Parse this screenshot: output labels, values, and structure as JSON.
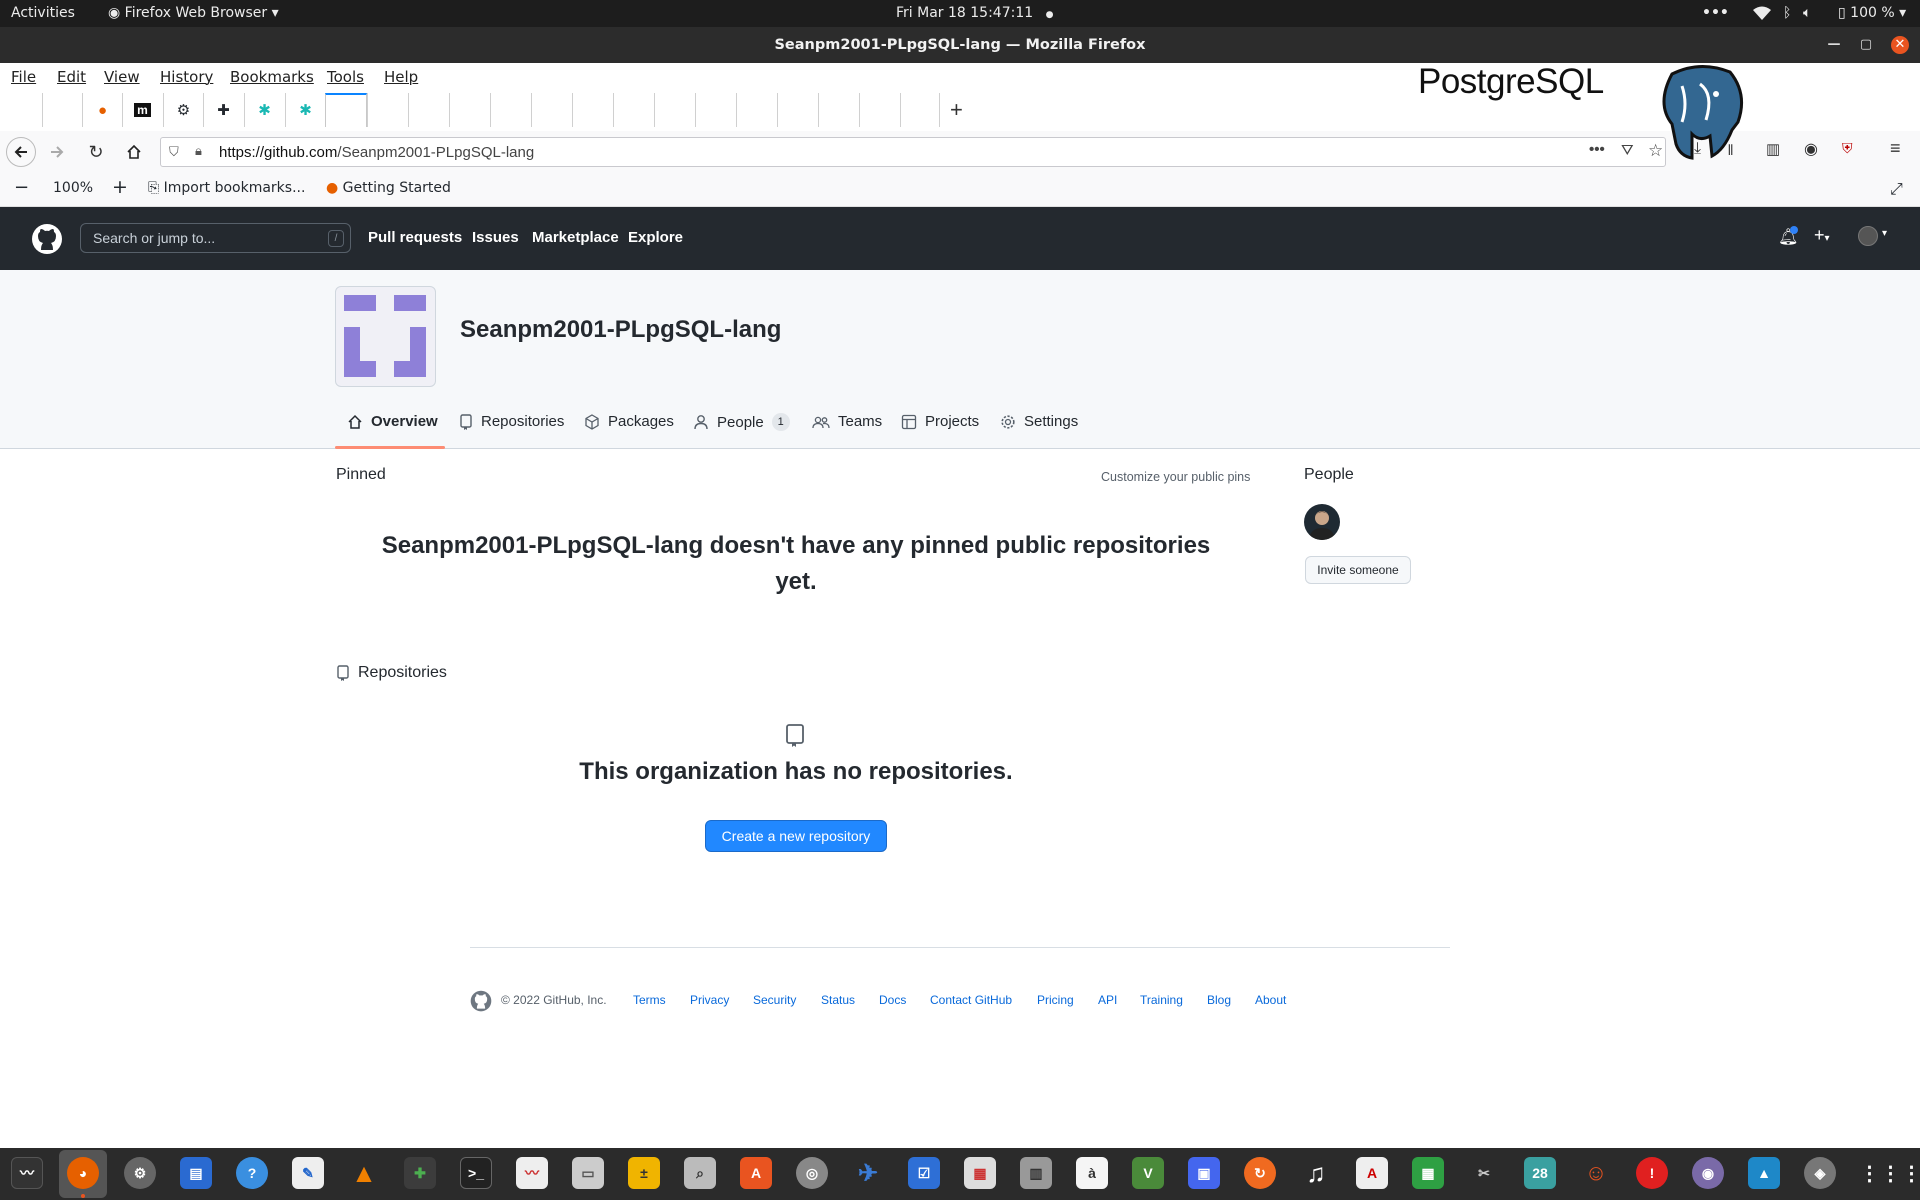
{
  "gnome": {
    "activities": "Activities",
    "app_menu": "Firefox Web Browser",
    "datetime": "Fri Mar 18  15:47:11",
    "battery": "100 %"
  },
  "window": {
    "title": "Seanpm2001-PLpgSQL-lang — Mozilla Firefox"
  },
  "menu": [
    "File",
    "Edit",
    "View",
    "History",
    "Bookmarks",
    "Tools",
    "Help"
  ],
  "overlay_logo": {
    "text": "PostgreSQL",
    "colors": {
      "blue": "#336791",
      "dark": "#111111"
    }
  },
  "nav": {
    "url_domain": "https://github.com",
    "url_path": "/Seanpm2001-PLpgSQL-lang"
  },
  "bookmarks": {
    "zoom": "100%",
    "import": "Import bookmarks...",
    "getting_started": "Getting Started"
  },
  "github": {
    "search_placeholder": "Search or jump to...",
    "search_shortcut": "/",
    "nav": [
      "Pull requests",
      "Issues",
      "Marketplace",
      "Explore"
    ]
  },
  "org": {
    "name": "Seanpm2001-PLpgSQL-lang",
    "tabs": {
      "overview": "Overview",
      "repositories": "Repositories",
      "packages": "Packages",
      "people": "People",
      "people_count": "1",
      "teams": "Teams",
      "projects": "Projects",
      "settings": "Settings"
    }
  },
  "main": {
    "pinned_heading": "Pinned",
    "customize_pins": "Customize your public pins",
    "no_pinned_line1": "Seanpm2001-PLpgSQL-lang doesn't have any pinned public repositories",
    "no_pinned_line2": "yet.",
    "repos_heading": "Repositories",
    "no_repos": "This organization has no repositories.",
    "create_repo": "Create a new repository"
  },
  "sidebar": {
    "people_heading": "People",
    "invite": "Invite someone"
  },
  "footer": {
    "copyright": "© 2022 GitHub, Inc.",
    "links": [
      "Terms",
      "Privacy",
      "Security",
      "Status",
      "Docs",
      "Contact GitHub",
      "Pricing",
      "API",
      "Training",
      "Blog",
      "About"
    ]
  },
  "dock": {
    "calendar_day": "28"
  },
  "colors": {
    "github_header": "#24292f",
    "primary_button": "#2188ff",
    "tab_underline": "#fd8c73",
    "ubuntu_orange": "#e95420",
    "avatar_purple": "#8e80d8"
  }
}
